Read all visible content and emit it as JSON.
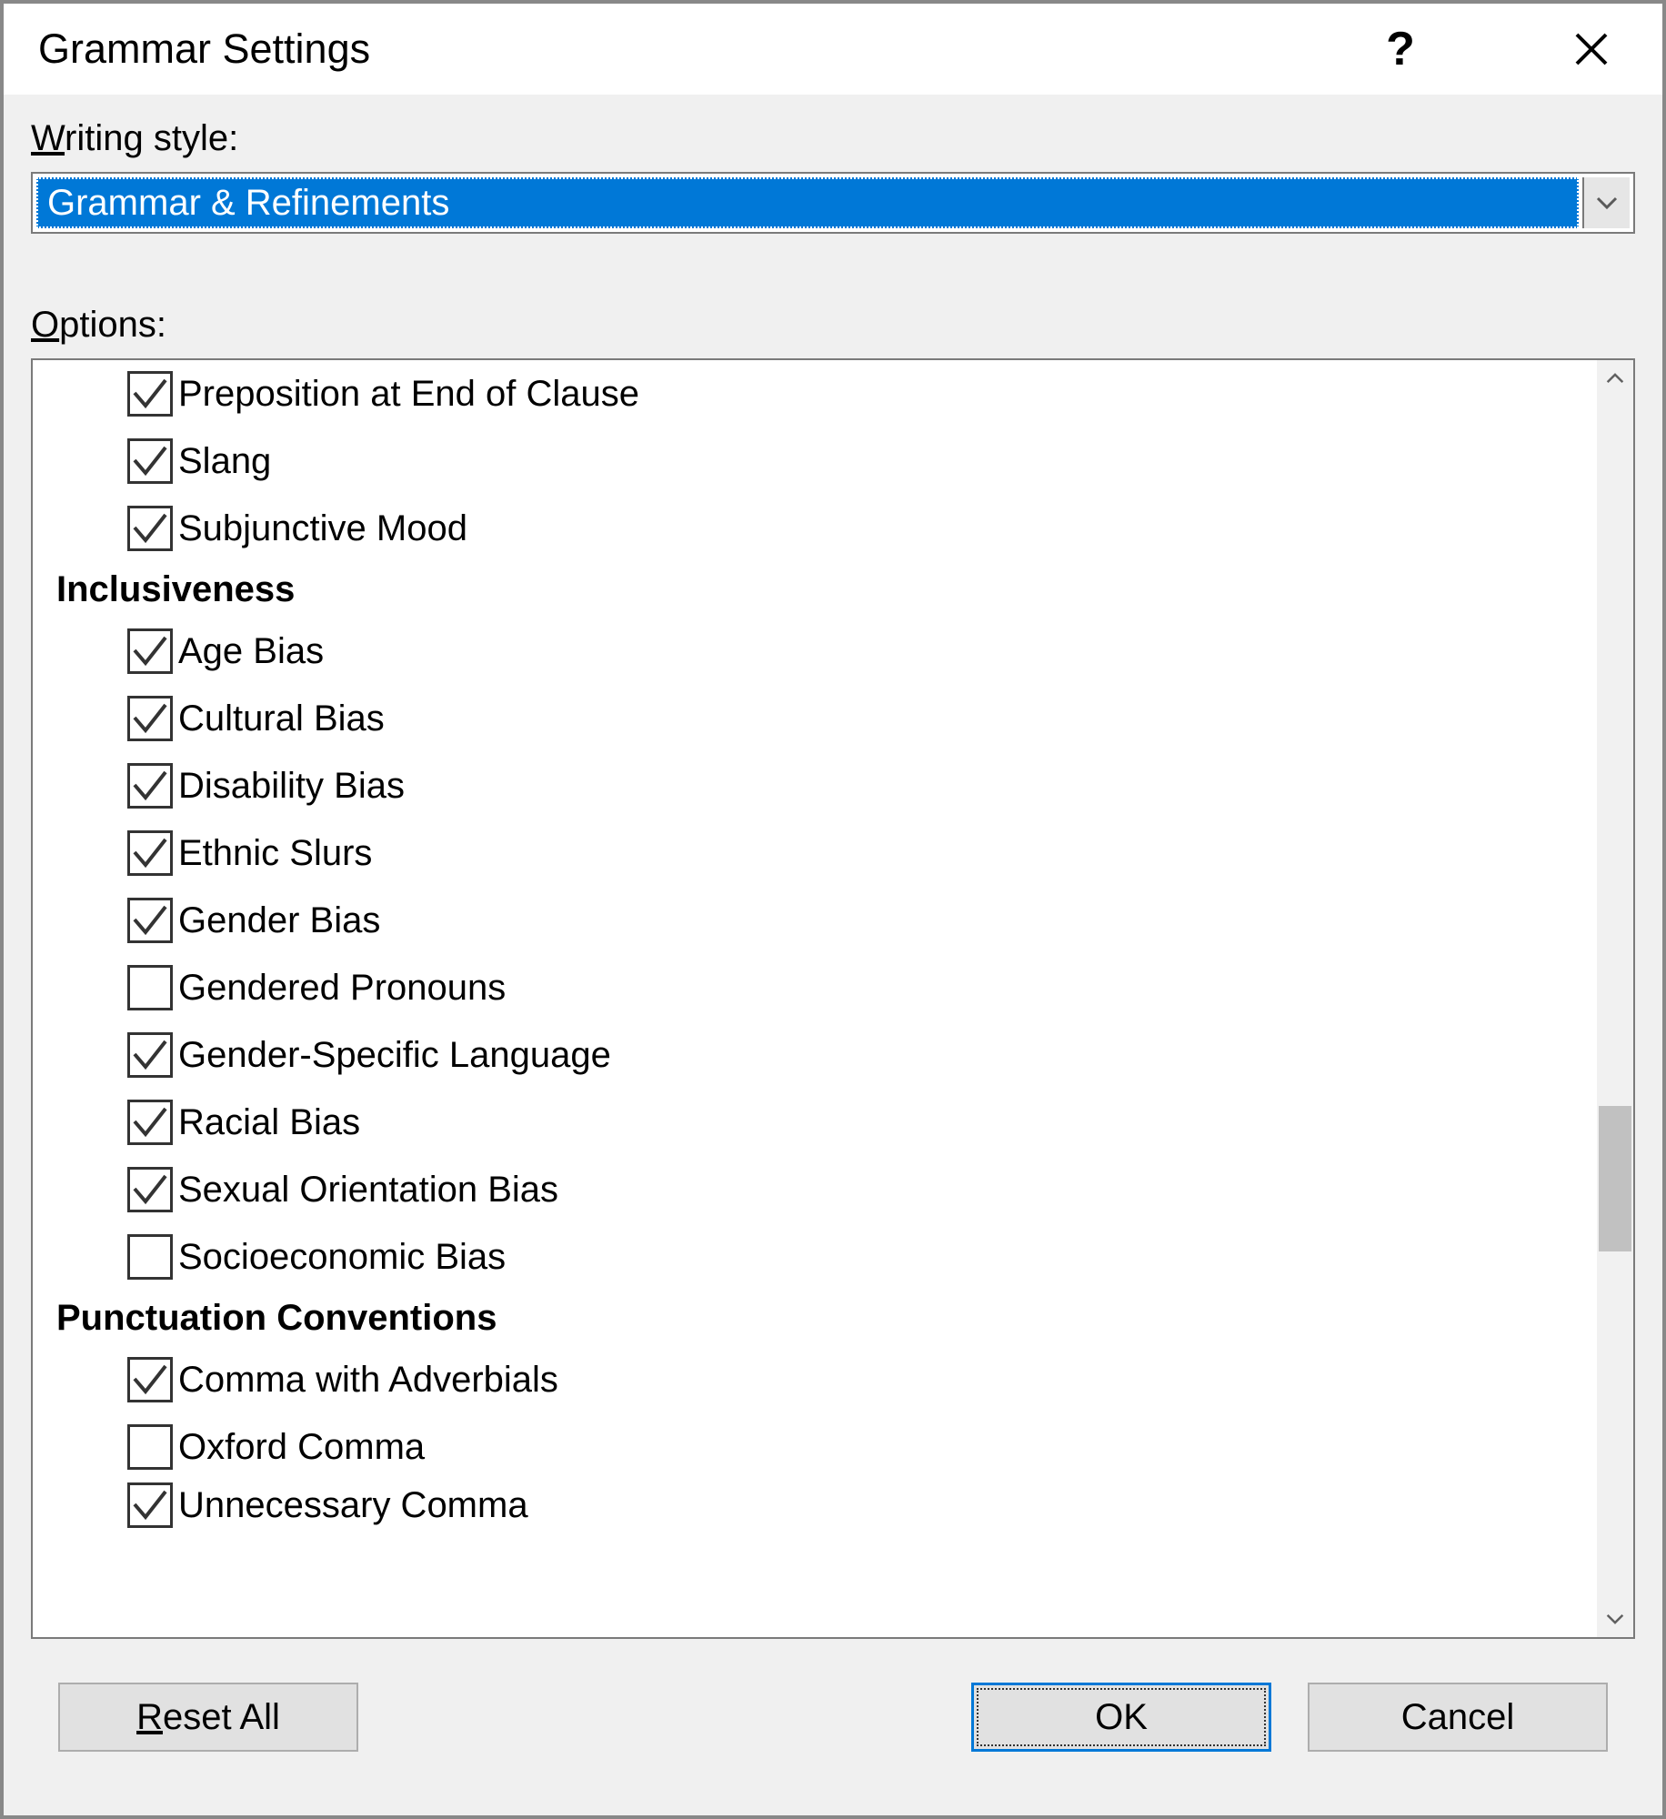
{
  "title": "Grammar Settings",
  "writing_style_label_pre": "W",
  "writing_style_label_post": "riting style:",
  "writing_style_value": "Grammar & Refinements",
  "options_label_pre": "O",
  "options_label_post": "ptions:",
  "groups": [
    {
      "header": null,
      "items": [
        {
          "label": "Preposition at End of Clause",
          "checked": true
        },
        {
          "label": "Slang",
          "checked": true
        },
        {
          "label": "Subjunctive Mood",
          "checked": true
        }
      ]
    },
    {
      "header": "Inclusiveness",
      "items": [
        {
          "label": "Age Bias",
          "checked": true
        },
        {
          "label": "Cultural Bias",
          "checked": true
        },
        {
          "label": "Disability Bias",
          "checked": true
        },
        {
          "label": "Ethnic Slurs",
          "checked": true
        },
        {
          "label": "Gender Bias",
          "checked": true
        },
        {
          "label": "Gendered Pronouns",
          "checked": false
        },
        {
          "label": "Gender-Specific Language",
          "checked": true
        },
        {
          "label": "Racial Bias",
          "checked": true
        },
        {
          "label": "Sexual Orientation Bias",
          "checked": true
        },
        {
          "label": "Socioeconomic Bias",
          "checked": false
        }
      ]
    },
    {
      "header": "Punctuation Conventions",
      "items": [
        {
          "label": "Comma with Adverbials",
          "checked": true
        },
        {
          "label": "Oxford Comma",
          "checked": false
        },
        {
          "label": "Unnecessary Comma",
          "checked": true
        }
      ]
    }
  ],
  "buttons": {
    "reset_pre": "R",
    "reset_post": "eset All",
    "ok": "OK",
    "cancel": "Cancel"
  }
}
